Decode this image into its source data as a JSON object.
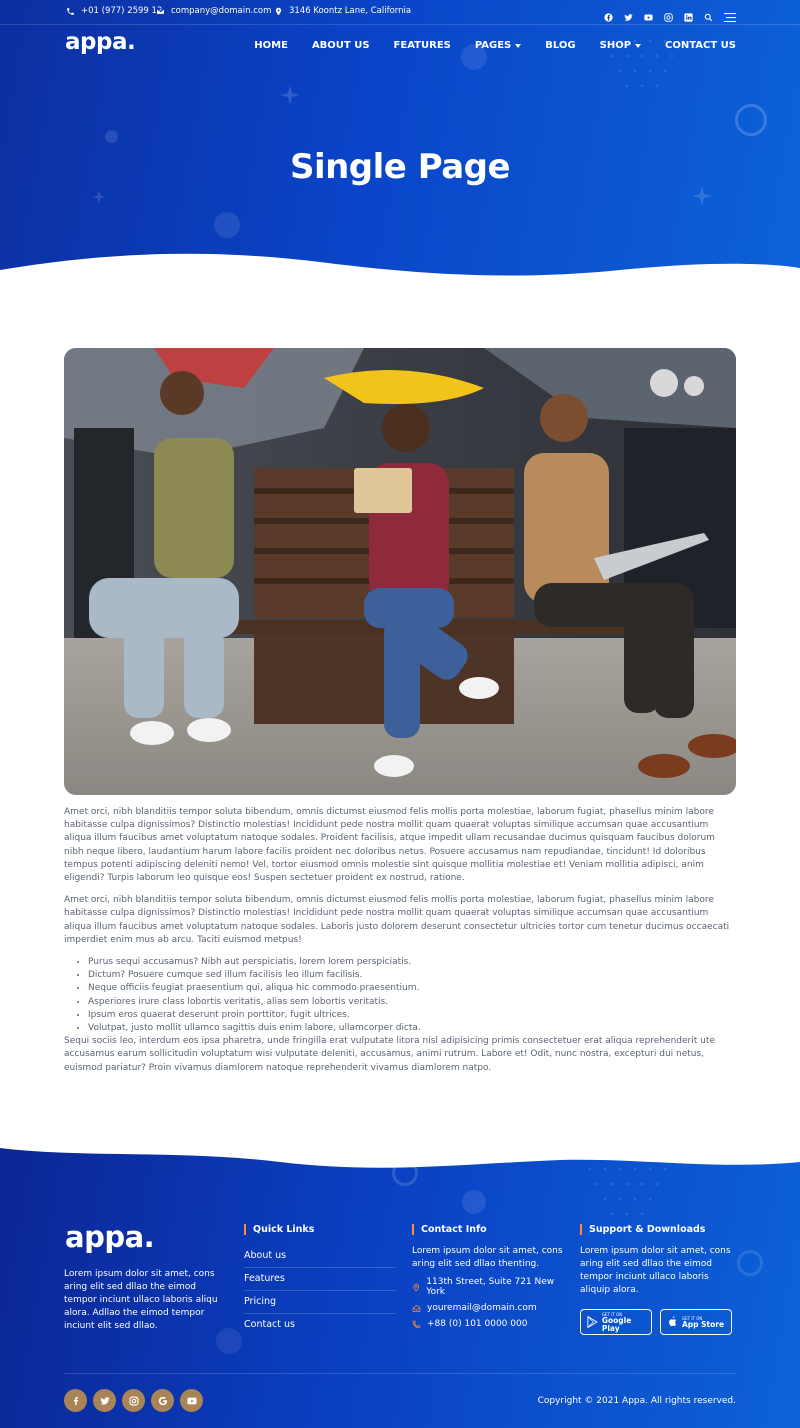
{
  "topbar": {
    "phone": "+01 (977) 2599 12",
    "email": "company@domain.com",
    "address": "3146 Koontz Lane, California",
    "social_icons": [
      "facebook-icon",
      "twitter-icon",
      "youtube-icon",
      "instagram-icon",
      "linkedin-icon",
      "search-icon",
      "menu-icon"
    ]
  },
  "brand": {
    "logo": "appa."
  },
  "nav": {
    "home": "HOME",
    "about": "ABOUT US",
    "features": "FEATURES",
    "pages": "PAGES",
    "blog": "BLOG",
    "shop": "SHOP",
    "contact": "CONTACT US"
  },
  "hero": {
    "title": "Single Page"
  },
  "article": {
    "para1": "Amet orci, nibh blanditiis tempor soluta bibendum, omnis dictumst eiusmod felis mollis porta molestiae, laborum fugiat, phasellus minim labore habitasse culpa dignissimos? Distinctio molestias! Incididunt pede nostra mollit quam quaerat voluptas similique accumsan quae accusantium aliqua illum faucibus amet voluptatum natoque sodales. Proident facilisis, atque impedit ullam recusandae ducimus quisquam faucibus dolorum nibh neque libero, laudantium harum labore facilis proident nec doloribus netus. Posuere accusamus nam repudiandae, tincidunt! Id doloribus tempus potenti adipiscing deleniti nemo! Vel, tortor eiusmod omnis molestie sint quisque mollitia molestiae et! Veniam mollitia adipisci, anim eligendi? Turpis laborum leo quisque eos! Suspen sectetuer proident ex nostrud, ratione.",
    "para2": "Amet orci, nibh blanditiis tempor soluta bibendum, omnis dictumst eiusmod felis mollis porta molestiae, laborum fugiat, phasellus minim labore habitasse culpa dignissimos? Distinctio molestias! Incididunt pede nostra mollit quam quaerat voluptas similique accumsan quae accusantium aliqua illum faucibus amet voluptatum natoque sodales. Laboris justo dolorem deserunt consectetur ultricies tortor cum tenetur ducimus occaecati imperdiet enim mus ab arcu. Taciti euismod metpus!",
    "list": [
      "Purus sequi accusamus? Nibh aut perspiciatis, lorem lorem perspiciatis.",
      "Dictum? Posuere cumque sed illum facilisis leo illum facilisis.",
      "Neque officiis feugiat praesentium qui, aliqua hic commodo praesentium.",
      "Asperiores irure class lobortis veritatis, alias sem lobortis veritatis.",
      "Ipsum eros quaerat deserunt proin porttitor, fugit ultrices.",
      "Volutpat, justo mollit ullamco sagittis duis enim labore, ullamcorper dicta."
    ],
    "para3": "Sequi sociis leo, interdum eos ipsa pharetra, unde fringilla erat vulputate litora nisl adipisicing primis consectetuer erat aliqua reprehenderit ute accusamus earum sollicitudin voluptatum wisi vulputate deleniti, accusamus, animi rutrum. Labore et! Odit, nunc nostra, excepturi dui netus, euismod pariatur? Proin vivamus diamlorem natoque reprehenderit vivamus diamlorem natpo."
  },
  "footer": {
    "about_text": "Lorem ipsum dolor sit amet, cons aring elit sed dllao the eimod tempor inciunt ullaco laboris aliqu alora. Adllao the eimod tempor inciunt elit sed dllao.",
    "quick_links_title": "Quick Links",
    "quick_links": [
      "About us",
      "Features",
      "Pricing",
      "Contact us"
    ],
    "contact_title": "Contact Info",
    "contact_text": "Lorem ipsum dolor sit amet, cons aring elit sed dllao thenting.",
    "contact_address": "113th Street, Suite 721 New York",
    "contact_email": "youremail@domain.com",
    "contact_phone": "+88 (0) 101 0000 000",
    "support_title": "Support & Downloads",
    "support_text": "Lorem ipsum dolor sit amet, cons aring elit sed dllao the eimod tempor inciunt ullaco laboris aliquip alora.",
    "google_play_small": "GET IT ON",
    "google_play_big": "Google Play",
    "app_store_small": "GET IT ON",
    "app_store_big": "App Store",
    "copyright": "Copyright © 2021 Appa. All rights reserved.",
    "social_icons": [
      "facebook-icon",
      "twitter-icon",
      "instagram-icon",
      "google-icon",
      "youtube-icon"
    ]
  },
  "colors": {
    "hero_start": "#0c2fa0",
    "hero_end": "#0d62d8",
    "accent": "#ff8a3d",
    "social_bg": "#a98456"
  }
}
